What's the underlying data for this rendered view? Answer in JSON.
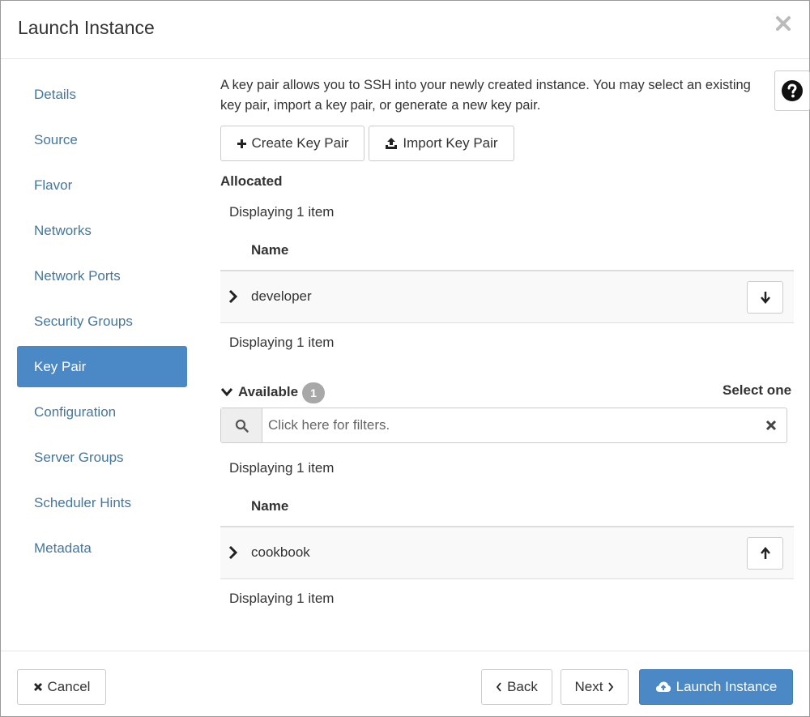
{
  "dialog": {
    "title": "Launch Instance"
  },
  "sidebar": {
    "items": [
      {
        "label": "Details",
        "active": false
      },
      {
        "label": "Source",
        "active": false
      },
      {
        "label": "Flavor",
        "active": false
      },
      {
        "label": "Networks",
        "active": false
      },
      {
        "label": "Network Ports",
        "active": false
      },
      {
        "label": "Security Groups",
        "active": false
      },
      {
        "label": "Key Pair",
        "active": true
      },
      {
        "label": "Configuration",
        "active": false
      },
      {
        "label": "Server Groups",
        "active": false
      },
      {
        "label": "Scheduler Hints",
        "active": false
      },
      {
        "label": "Metadata",
        "active": false
      }
    ]
  },
  "main": {
    "description": "A key pair allows you to SSH into your newly created instance. You may select an existing key pair, import a key pair, or generate a new key pair.",
    "create_button": "Create Key Pair",
    "import_button": "Import Key Pair",
    "allocated": {
      "heading": "Allocated",
      "count_text_top": "Displaying 1 item",
      "column_name": "Name",
      "rows": [
        {
          "name": "developer"
        }
      ],
      "count_text_bottom": "Displaying 1 item"
    },
    "available": {
      "heading": "Available",
      "badge_count": "1",
      "select_hint": "Select one",
      "filter_placeholder": "Click here for filters.",
      "count_text_top": "Displaying 1 item",
      "column_name": "Name",
      "rows": [
        {
          "name": "cookbook"
        }
      ],
      "count_text_bottom": "Displaying 1 item"
    }
  },
  "footer": {
    "cancel_label": "Cancel",
    "back_label": "Back",
    "next_label": "Next",
    "launch_label": "Launch Instance"
  },
  "colors": {
    "accent": "#4a88c6",
    "nav_link": "#44779f",
    "badge": "#a8a8a8"
  },
  "icons": {
    "close": "close-icon",
    "help": "question-circle-icon",
    "create": "plus-icon",
    "import": "upload-icon",
    "expand": "chevron-right-icon",
    "collapse": "chevron-down-icon",
    "deallocate": "arrow-down-icon",
    "allocate": "arrow-up-icon",
    "search": "search-icon",
    "clear": "times-icon",
    "cancel": "times-icon",
    "back": "chevron-left-icon",
    "next": "chevron-right-icon",
    "launch": "cloud-upload-icon"
  }
}
